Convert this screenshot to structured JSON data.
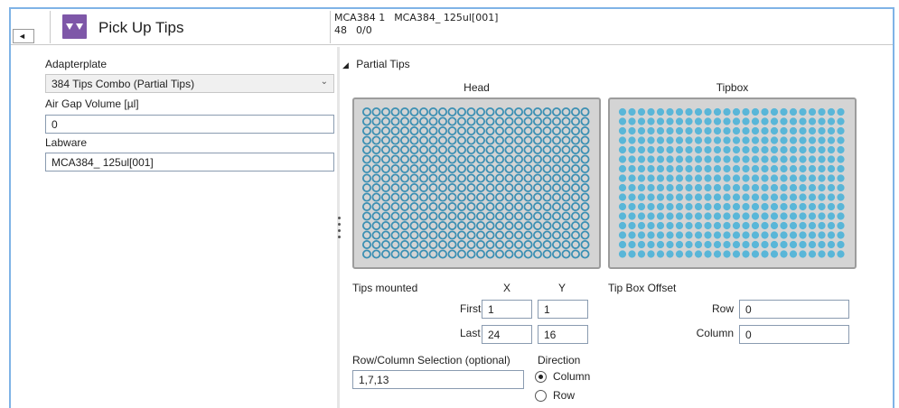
{
  "header": {
    "title": "Pick Up Tips",
    "info_line1_a": "MCA384 1",
    "info_line1_b": "MCA384_ 125ul[001]",
    "info_line2_a": "48",
    "info_line2_b": "0/0",
    "collapse_glyph": "◄",
    "icon": "pick-up-tips-icon"
  },
  "left": {
    "adapterplate_label": "Adapterplate",
    "adapterplate_value": "384 Tips Combo (Partial Tips)",
    "air_gap_label": "Air Gap Volume [µl]",
    "air_gap_value": "0",
    "labware_label": "Labware",
    "labware_value": "MCA384_ 125ul[001]"
  },
  "partial": {
    "section_title": "Partial Tips",
    "head_label": "Head",
    "tipbox_label": "Tipbox",
    "head_grid": {
      "columns": 24,
      "rows": 16,
      "style": "outline"
    },
    "tipbox_grid": {
      "columns": 24,
      "rows": 16,
      "style": "filled"
    },
    "colors": {
      "tip_fill": "#59b6d8",
      "tip_outline": "#3b8fb3",
      "plate_bg": "#d4d4d4"
    },
    "tips_mounted_label": "Tips mounted",
    "x_label": "X",
    "y_label": "Y",
    "first_label": "First",
    "first_x": "1",
    "first_y": "1",
    "last_label": "Last",
    "last_x": "24",
    "last_y": "16",
    "tipbox_offset_label": "Tip Box Offset",
    "row_label": "Row",
    "row_value": "0",
    "column_label": "Column",
    "column_value": "0",
    "rowcol_selection_label": "Row/Column Selection (optional)",
    "rowcol_selection_value": "1,7,13",
    "direction_label": "Direction",
    "direction_options": [
      "Column",
      "Row"
    ],
    "direction_selected": "Column"
  }
}
